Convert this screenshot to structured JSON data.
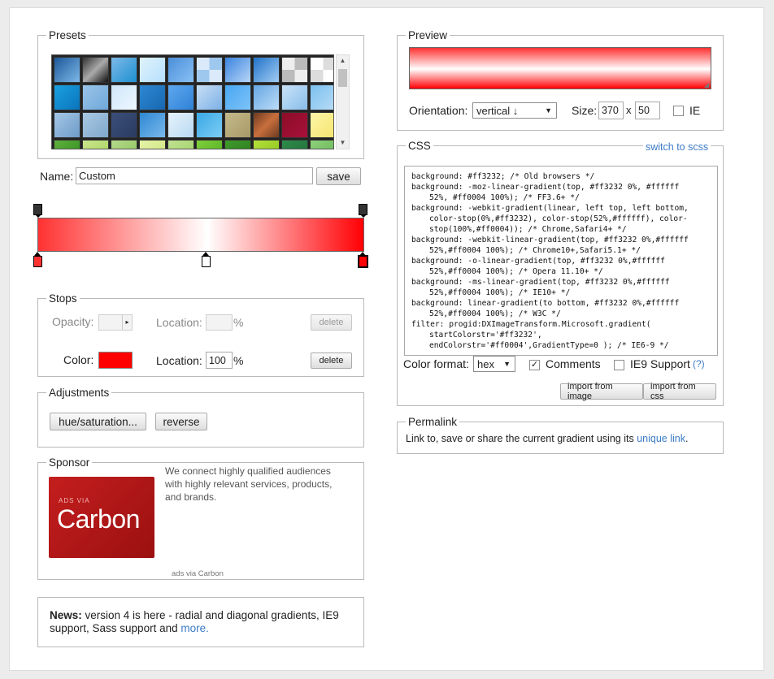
{
  "presets": {
    "legend": "Presets",
    "swatches": [
      "linear-gradient(135deg,#1e5799,#7db9e8)",
      "linear-gradient(135deg,#333,#aaa,#111)",
      "linear-gradient(135deg,#7db9e8,#1e90d0)",
      "linear-gradient(135deg,#e0f3fa,#b6dffd)",
      "linear-gradient(135deg,#4b8fd9,#89c0f5)",
      "repeating-conic-gradient(#9fc8ef 0 25%,#dbeafb 0 50%)",
      "linear-gradient(135deg,#3a84df,#b8d6f7)",
      "linear-gradient(135deg,#2173c9,#a2cdf3)",
      "repeating-conic-gradient(#bbb 0 25%,#eee 0 50%)",
      "repeating-conic-gradient(#ddd 0 25%,#fff 0 50%)",
      "linear-gradient(135deg,#1aa0e0,#0b74bb)",
      "linear-gradient(135deg,#9bc4e8,#6ea8da)",
      "linear-gradient(135deg,#cfe7fa,#eef7ff)",
      "linear-gradient(135deg,#2e88d3,#1767b0)",
      "linear-gradient(135deg,#5ea7ee,#2f82d8)",
      "linear-gradient(135deg,#c8def5,#7cb1e6)",
      "linear-gradient(135deg,#49a7f0,#7dc3fa)",
      "linear-gradient(135deg,#67a7e3,#bcdcf7)",
      "linear-gradient(135deg,#c9e3f8,#88bde9)",
      "linear-gradient(135deg,#7bc0ef,#b9dcf6)",
      "linear-gradient(135deg,#a5c7e6,#6d9bc8)",
      "linear-gradient(135deg,#a9c9e2,#7fa8cc)",
      "linear-gradient(135deg,#3b4f7a,#2a3b60)",
      "linear-gradient(135deg,#2e88d3,#7ab8ec)",
      "linear-gradient(135deg,#e6f3fc,#b9d9f2)",
      "linear-gradient(135deg,#3aa8e6,#7dcdf4)",
      "linear-gradient(135deg,#c5b98d,#a89a66)",
      "linear-gradient(135deg,#6d3b22,#c86f3c,#6d3b22)",
      "linear-gradient(135deg,#8c0d28,#a8103a)",
      "linear-gradient(135deg,#fdf5a8,#f5e56d)",
      "linear-gradient(135deg,#5fb03c,#2e8b1e)",
      "linear-gradient(135deg,#c9e58b,#a8d35e)",
      "linear-gradient(135deg,#b4d98a,#8dc35a)",
      "linear-gradient(135deg,#e6f3a8,#cbe57a)",
      "linear-gradient(135deg,#bfe18f,#9fd067)",
      "linear-gradient(135deg,#7fcf3a,#4fae22)",
      "linear-gradient(135deg,#3f9a2a,#2a7a1e)",
      "linear-gradient(135deg,#b2df38,#8cc21e)",
      "linear-gradient(135deg,#2e8a4a,#1f6e38)",
      "linear-gradient(135deg,#8ed07a,#62b552)"
    ]
  },
  "name": {
    "label": "Name:",
    "value": "Custom",
    "save_label": "save"
  },
  "gradient": {
    "css": "linear-gradient(to right,#ff3232 0%,#ffffff 52%,#ff0004 100%)",
    "color_stops": [
      {
        "location": 0,
        "color": "#ff3232"
      },
      {
        "location": 52,
        "color": "#ffffff"
      },
      {
        "location": 100,
        "color": "#ff0004"
      }
    ],
    "opacity_stops": [
      0,
      100
    ]
  },
  "stops": {
    "legend": "Stops",
    "opacity_label": "Opacity:",
    "location_label": "Location:",
    "percent": "%",
    "delete_label": "delete",
    "color_label": "Color:",
    "color_value": "#ff0000",
    "color_location": "100"
  },
  "adjustments": {
    "legend": "Adjustments",
    "hue_label": "hue/saturation...",
    "reverse_label": "reverse"
  },
  "sponsor": {
    "legend": "Sponsor",
    "ad_small": "ADS VIA",
    "ad_brand": "Carbon",
    "text": "We connect highly qualified audiences with highly relevant services, products, and brands.",
    "footer": "ads via Carbon"
  },
  "news": {
    "strong": "News:",
    "text": " version 4 is here - radial and diagonal gradients, IE9 support, Sass support and ",
    "link": "more."
  },
  "preview": {
    "legend": "Preview",
    "orientation_label": "Orientation:",
    "orientation_value": "vertical ↓",
    "size_label": "Size:",
    "width": "370",
    "x": "x",
    "height": "50",
    "ie_label": "IE"
  },
  "css": {
    "legend": "CSS",
    "switch_label": "switch to scss",
    "lines": [
      {
        "t": "background: #ff3232; /* Old browsers */",
        "i": false
      },
      {
        "t": "background: -moz-linear-gradient(top, #ff3232 0%, #ffffff",
        "i": false
      },
      {
        "t": "52%, #ff0004 100%); /* FF3.6+ */",
        "i": true
      },
      {
        "t": "background: -webkit-gradient(linear, left top, left bottom,",
        "i": false
      },
      {
        "t": "color-stop(0%,#ff3232), color-stop(52%,#ffffff), color-",
        "i": true
      },
      {
        "t": "stop(100%,#ff0004)); /* Chrome,Safari4+ */",
        "i": true
      },
      {
        "t": "background: -webkit-linear-gradient(top, #ff3232 0%,#ffffff",
        "i": false
      },
      {
        "t": "52%,#ff0004 100%); /* Chrome10+,Safari5.1+ */",
        "i": true
      },
      {
        "t": "background: -o-linear-gradient(top, #ff3232 0%,#ffffff",
        "i": false
      },
      {
        "t": "52%,#ff0004 100%); /* Opera 11.10+ */",
        "i": true
      },
      {
        "t": "background: -ms-linear-gradient(top, #ff3232 0%,#ffffff",
        "i": false
      },
      {
        "t": "52%,#ff0004 100%); /* IE10+ */",
        "i": true
      },
      {
        "t": "background: linear-gradient(to bottom, #ff3232 0%,#ffffff",
        "i": false
      },
      {
        "t": "52%,#ff0004 100%); /* W3C */",
        "i": true
      },
      {
        "t": "filter: progid:DXImageTransform.Microsoft.gradient(",
        "i": false
      },
      {
        "t": "startColorstr='#ff3232',",
        "i": true
      },
      {
        "t": "endColorstr='#ff0004',GradientType=0 ); /* IE6-9 */",
        "i": true
      }
    ],
    "format_label": "Color format:",
    "format_value": "hex",
    "comments_label": "Comments",
    "ie9_label": "IE9 Support",
    "ie9_help": "(?)",
    "import_image_label": "import from image",
    "import_css_label": "import from css"
  },
  "permalink": {
    "legend": "Permalink",
    "text": "Link to, save or share the current gradient using its ",
    "link": "unique link",
    "end": "."
  }
}
